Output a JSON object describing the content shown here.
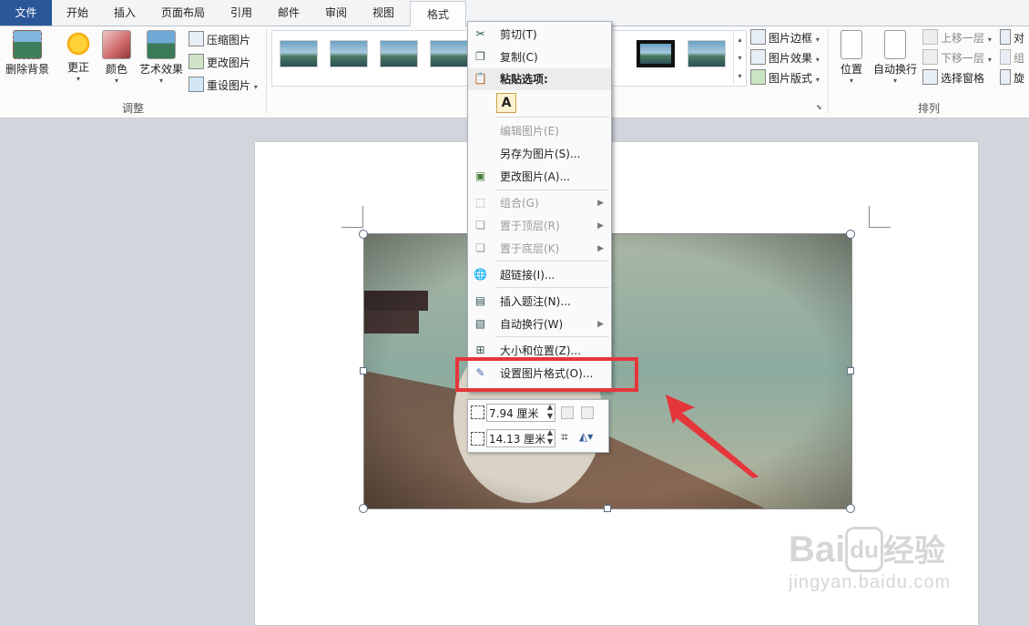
{
  "tabs": [
    {
      "label": "文件"
    },
    {
      "label": "开始"
    },
    {
      "label": "插入"
    },
    {
      "label": "页面布局"
    },
    {
      "label": "引用"
    },
    {
      "label": "邮件"
    },
    {
      "label": "审阅"
    },
    {
      "label": "视图"
    },
    {
      "label": "格式"
    }
  ],
  "ribbon": {
    "remove_bg": "删除背景",
    "corrections": "更正",
    "color": "颜色",
    "artistic": "艺术效果",
    "compress": "压缩图片",
    "change": "更改图片",
    "reset": "重设图片",
    "adjust_group": "调整",
    "picture_border": "图片边框",
    "picture_effects": "图片效果",
    "picture_layout": "图片版式",
    "position": "位置",
    "wrap_text": "自动换行",
    "bring_forward": "上移一层",
    "send_backward": "下移一层",
    "selection_pane": "选择窗格",
    "align_partial": "对",
    "group_partial": "组",
    "rotate_partial": "旋",
    "arrange_group": "排列"
  },
  "context_menu": {
    "cut": "剪切(T)",
    "copy": "复制(C)",
    "paste_options": "粘贴选项:",
    "paste_keep_text": "A",
    "edit_picture": "编辑图片(E)",
    "save_as_picture": "另存为图片(S)...",
    "change_picture": "更改图片(A)...",
    "group": "组合(G)",
    "bring_to_front": "置于顶层(R)",
    "send_to_back": "置于底层(K)",
    "hyperlink": "超链接(I)...",
    "insert_caption": "插入题注(N)...",
    "wrap_text": "自动换行(W)",
    "size_position": "大小和位置(Z)...",
    "format_picture": "设置图片格式(O)..."
  },
  "mini_toolbar": {
    "height_value": "7.94 厘米",
    "width_value": "14.13 厘米"
  },
  "watermark": {
    "brand": "Bai",
    "brand_du": "du",
    "brand_cn": "经验",
    "url": "jingyan.baidu.com"
  },
  "colors": {
    "file_tab": "#2b579a",
    "highlight": "#e5363b"
  }
}
